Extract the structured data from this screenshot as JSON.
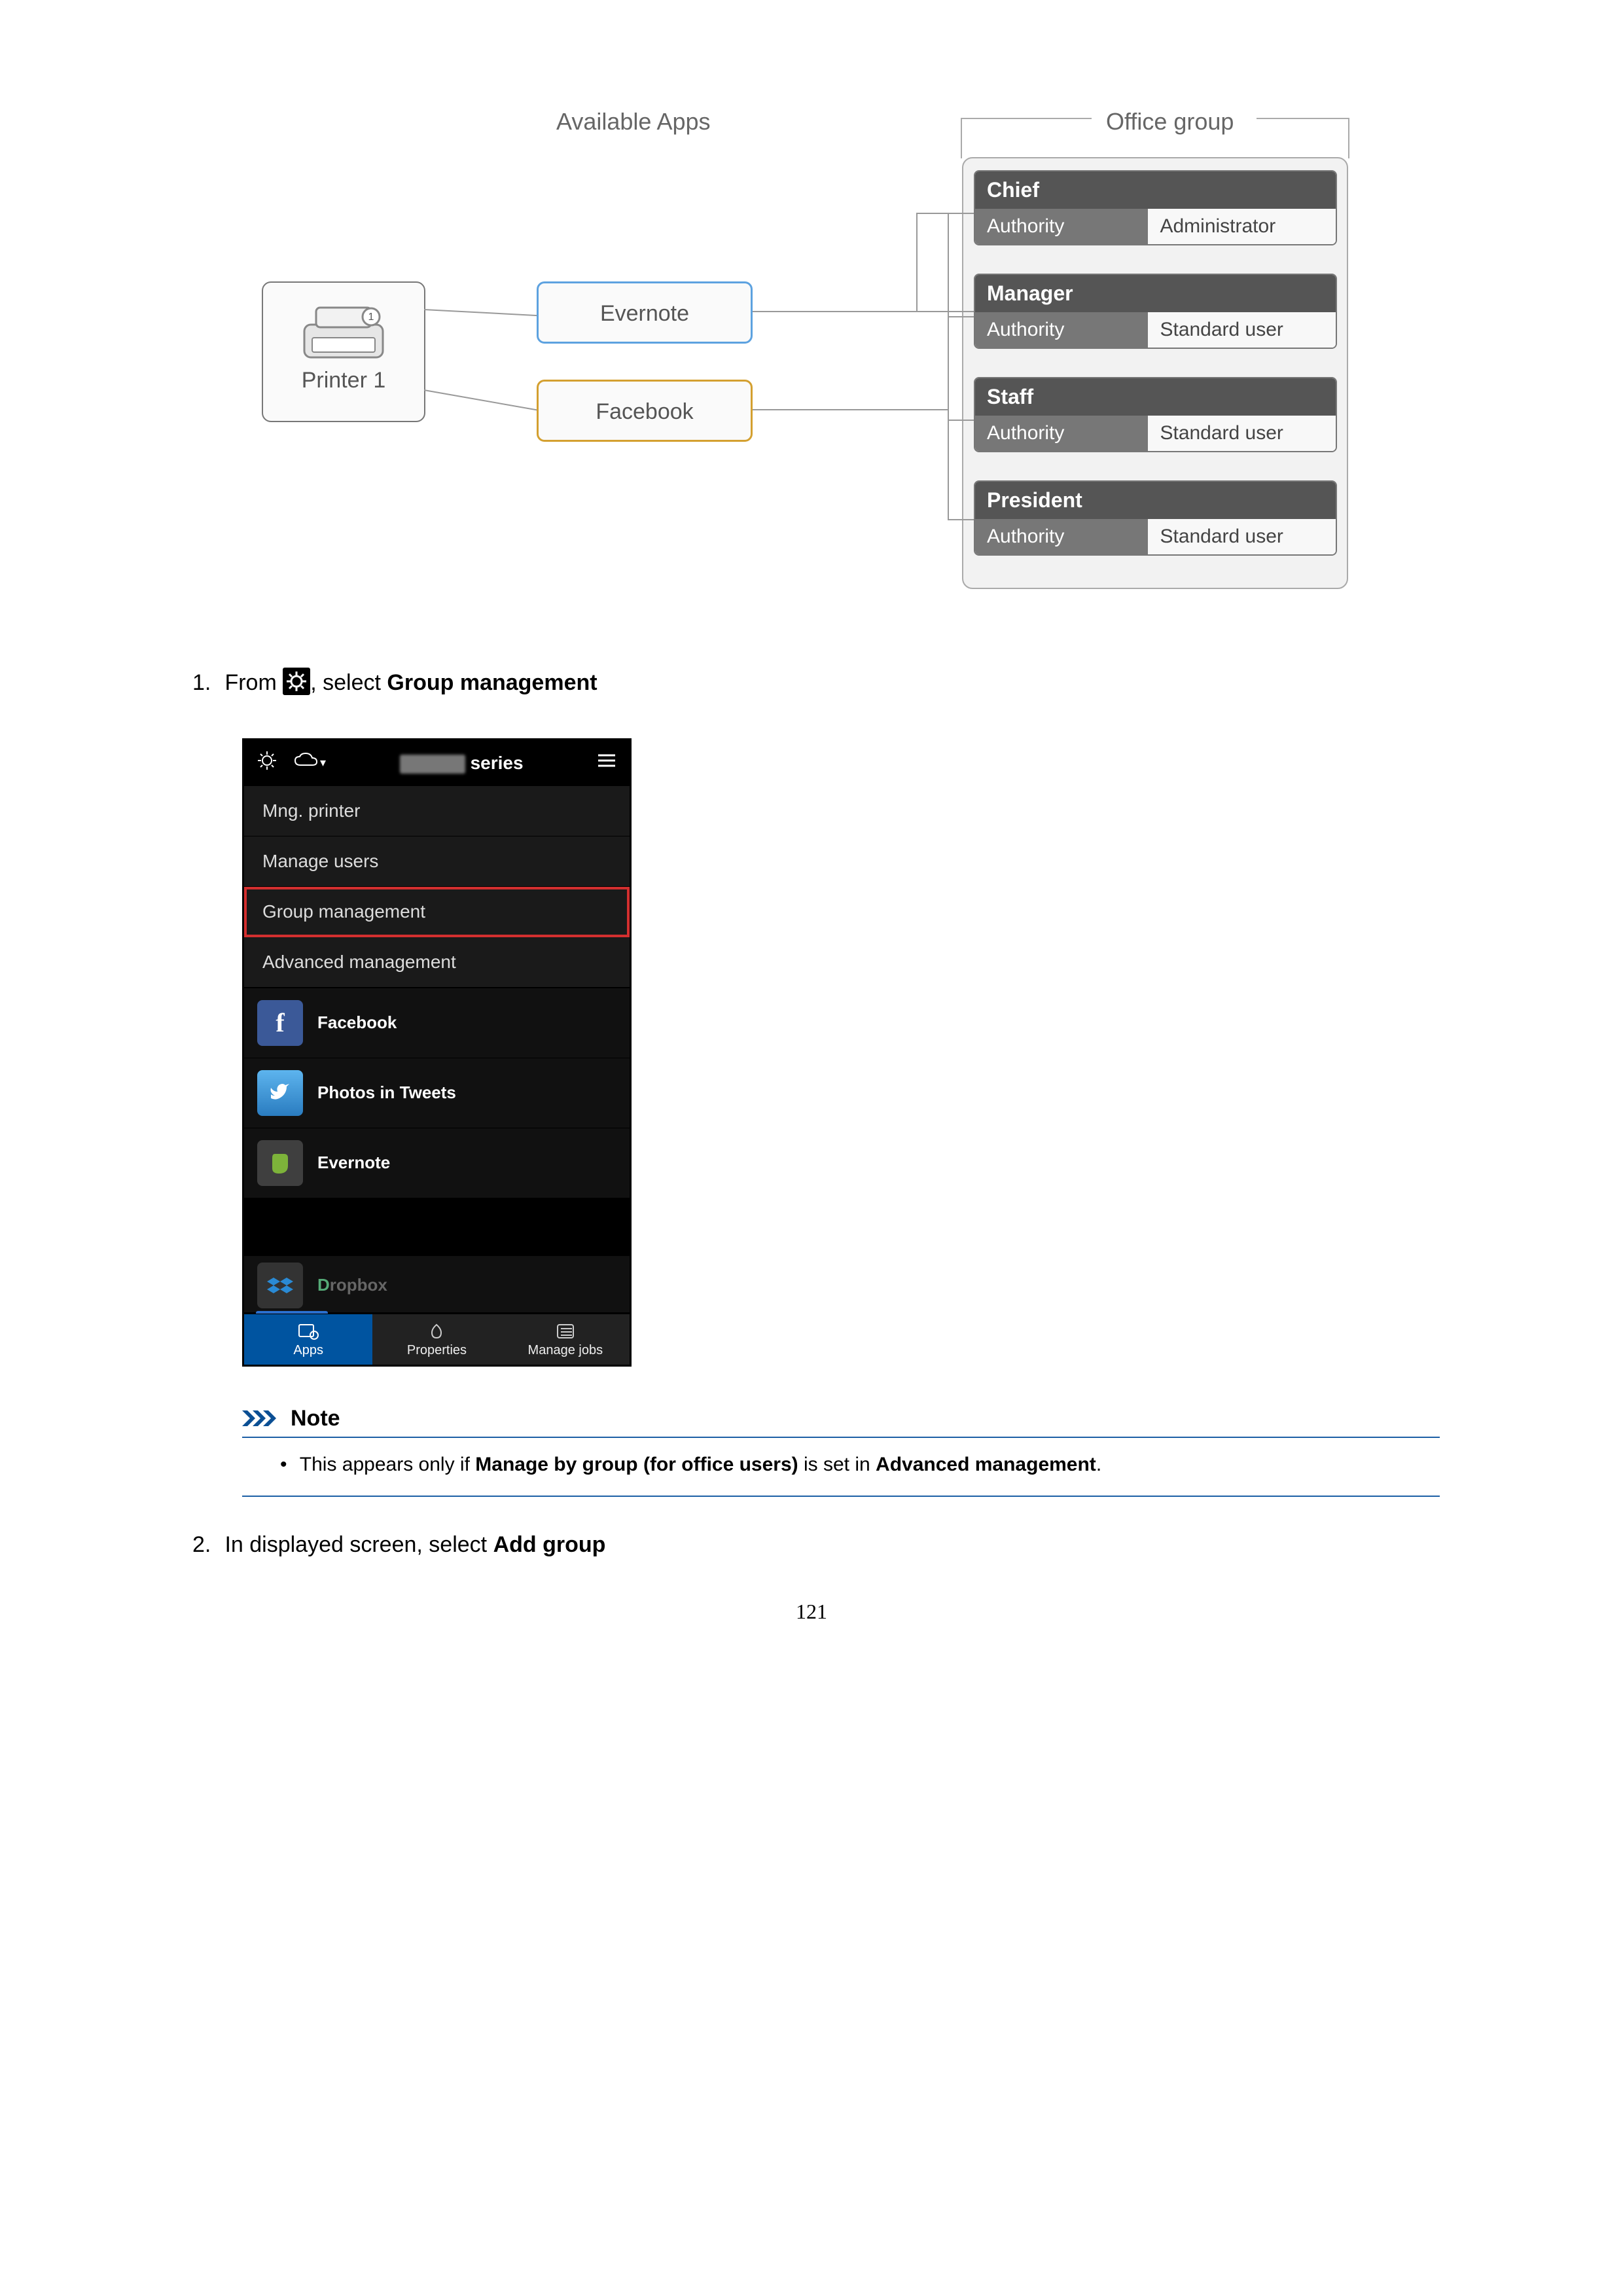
{
  "diagram": {
    "available_title": "Available Apps",
    "group_title": "Office group",
    "printer_label": "Printer 1",
    "app_evernote": "Evernote",
    "app_facebook": "Facebook",
    "roles": {
      "chief": {
        "name": "Chief",
        "auth_label": "Authority",
        "auth_value": "Administrator"
      },
      "manager": {
        "name": "Manager",
        "auth_label": "Authority",
        "auth_value": "Standard user"
      },
      "staff": {
        "name": "Staff",
        "auth_label": "Authority",
        "auth_value": "Standard user"
      },
      "president": {
        "name": "President",
        "auth_label": "Authority",
        "auth_value": "Standard user"
      }
    }
  },
  "step1": {
    "prefix": "From ",
    "mid": ", select ",
    "target": "Group management"
  },
  "phone": {
    "title_suffix": "series",
    "menu": {
      "mng_printer": "Mng. printer",
      "manage_users": "Manage users",
      "group_management": "Group management",
      "advanced_management": "Advanced management"
    },
    "apps": {
      "facebook": "Facebook",
      "photos_in_tweets": "Photos in Tweets",
      "evernote": "Evernote",
      "dropbox": "Dropbox"
    },
    "bottom_tabs": {
      "apps": "Apps",
      "properties": "Properties",
      "manage_jobs": "Manage jobs"
    }
  },
  "note": {
    "label": "Note",
    "text_prefix": "This appears only if ",
    "text_b1": "Manage by group (for office users)",
    "text_mid": " is set in ",
    "text_b2": "Advanced management",
    "text_suffix": "."
  },
  "step2": {
    "prefix": "In displayed screen, select ",
    "target": "Add group"
  },
  "page_number": "121"
}
